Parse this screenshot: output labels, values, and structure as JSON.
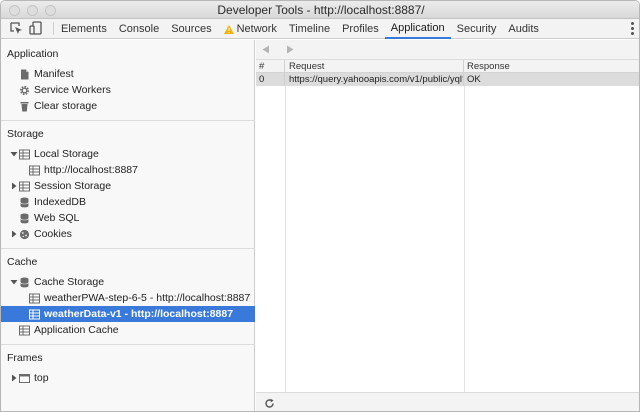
{
  "window": {
    "title": "Developer Tools - http://localhost:8887/"
  },
  "toolbar": {
    "inspect_icon": "inspect-element-icon",
    "device_icon": "device-mode-icon",
    "tabs": [
      {
        "label": "Elements"
      },
      {
        "label": "Console"
      },
      {
        "label": "Sources"
      },
      {
        "label": "Network",
        "icon": "warning-icon"
      },
      {
        "label": "Timeline"
      },
      {
        "label": "Profiles"
      },
      {
        "label": "Application",
        "active": true
      },
      {
        "label": "Security"
      },
      {
        "label": "Audits"
      }
    ],
    "menu_icon": "kebab-menu-icon",
    "accent_color": "#3879d9",
    "warning_color": "#f0b400"
  },
  "sidebar": {
    "application": {
      "title": "Application",
      "items": [
        {
          "label": "Manifest",
          "icon": "document-icon"
        },
        {
          "label": "Service Workers",
          "icon": "gear-icon"
        },
        {
          "label": "Clear storage",
          "icon": "trash-icon"
        }
      ]
    },
    "storage": {
      "title": "Storage",
      "local_storage": {
        "label": "Local Storage",
        "icon": "grid-icon",
        "expanded": true
      },
      "local_storage_origin": {
        "label": "http://localhost:8887",
        "icon": "grid-icon"
      },
      "session_storage": {
        "label": "Session Storage",
        "icon": "grid-icon",
        "expanded": false
      },
      "indexeddb": {
        "label": "IndexedDB",
        "icon": "database-icon"
      },
      "websql": {
        "label": "Web SQL",
        "icon": "database-icon"
      },
      "cookies": {
        "label": "Cookies",
        "icon": "cookie-icon",
        "expanded": false
      }
    },
    "cache": {
      "title": "Cache",
      "cache_storage": {
        "label": "Cache Storage",
        "icon": "database-icon",
        "expanded": true
      },
      "entries": [
        {
          "label": "weatherPWA-step-6-5 - http://localhost:8887",
          "icon": "grid-icon",
          "selected": false
        },
        {
          "label": "weatherData-v1 - http://localhost:8887",
          "icon": "grid-icon",
          "selected": true
        }
      ],
      "application_cache": {
        "label": "Application Cache",
        "icon": "grid-icon"
      }
    },
    "frames": {
      "title": "Frames",
      "top": {
        "label": "top",
        "icon": "frame-icon",
        "expanded": false
      }
    }
  },
  "main": {
    "nav": {
      "back_icon": "triangle-left-icon",
      "forward_icon": "triangle-right-icon"
    },
    "table": {
      "columns": [
        "#",
        "Request",
        "Response"
      ],
      "rows": [
        {
          "index": "0",
          "request": "https://query.yahooapis.com/v1/public/yql?f...",
          "response": "OK"
        }
      ]
    },
    "footer": {
      "refresh_icon": "refresh-icon"
    }
  }
}
